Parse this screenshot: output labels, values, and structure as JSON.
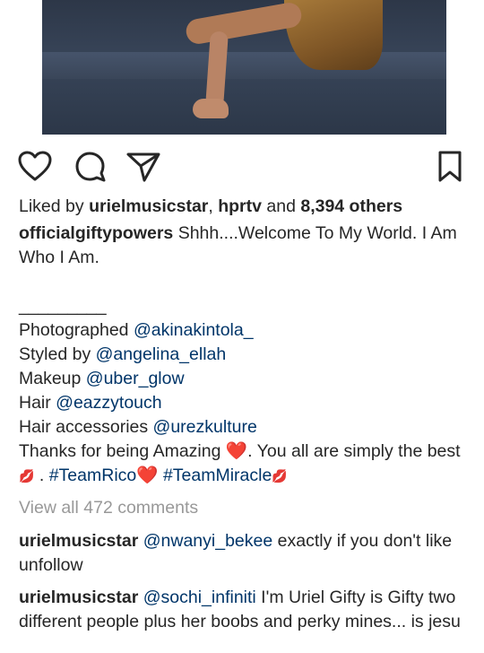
{
  "post": {
    "actions": [
      "like-icon",
      "comment-icon",
      "share-icon",
      "save-icon"
    ],
    "likes": {
      "prefix": "Liked by ",
      "user1": "urielmusicstar",
      "sep": ", ",
      "user2": "hprtv",
      "and": " and ",
      "count": "8,394 others"
    },
    "caption": {
      "username": "officialgiftypowers",
      "text": " Shhh....Welcome To My World. I Am Who I Am.",
      "divider": "_________",
      "credits": [
        {
          "label": "Photographed ",
          "handle": "@akinakintola_"
        },
        {
          "label": "Styled by ",
          "handle": "@angelina_ellah"
        },
        {
          "label": "Makeup ",
          "handle": "@uber_glow"
        },
        {
          "label": "Hair ",
          "handle": "@eazzytouch"
        },
        {
          "label": "Hair accessories ",
          "handle": "@urezkulture"
        }
      ],
      "thanks_a": "Thanks for being Amazing ",
      "heart": "❤️",
      "thanks_b": ". You all are simply the best",
      "lips": "💋",
      "dot": " . ",
      "tag1": "#TeamRico",
      "space": " ",
      "tag2": "#TeamMiracle"
    },
    "view_all": "View all 472 comments",
    "comments": [
      {
        "username": "urielmusicstar",
        "mention": "@nwanyi_bekee",
        "text": " exactly if you don't like unfollow"
      },
      {
        "username": "urielmusicstar",
        "mention": "@sochi_infiniti",
        "text": " I'm Uriel Gifty is Gifty two different people plus her boobs and perky mines... is jesu"
      }
    ]
  }
}
